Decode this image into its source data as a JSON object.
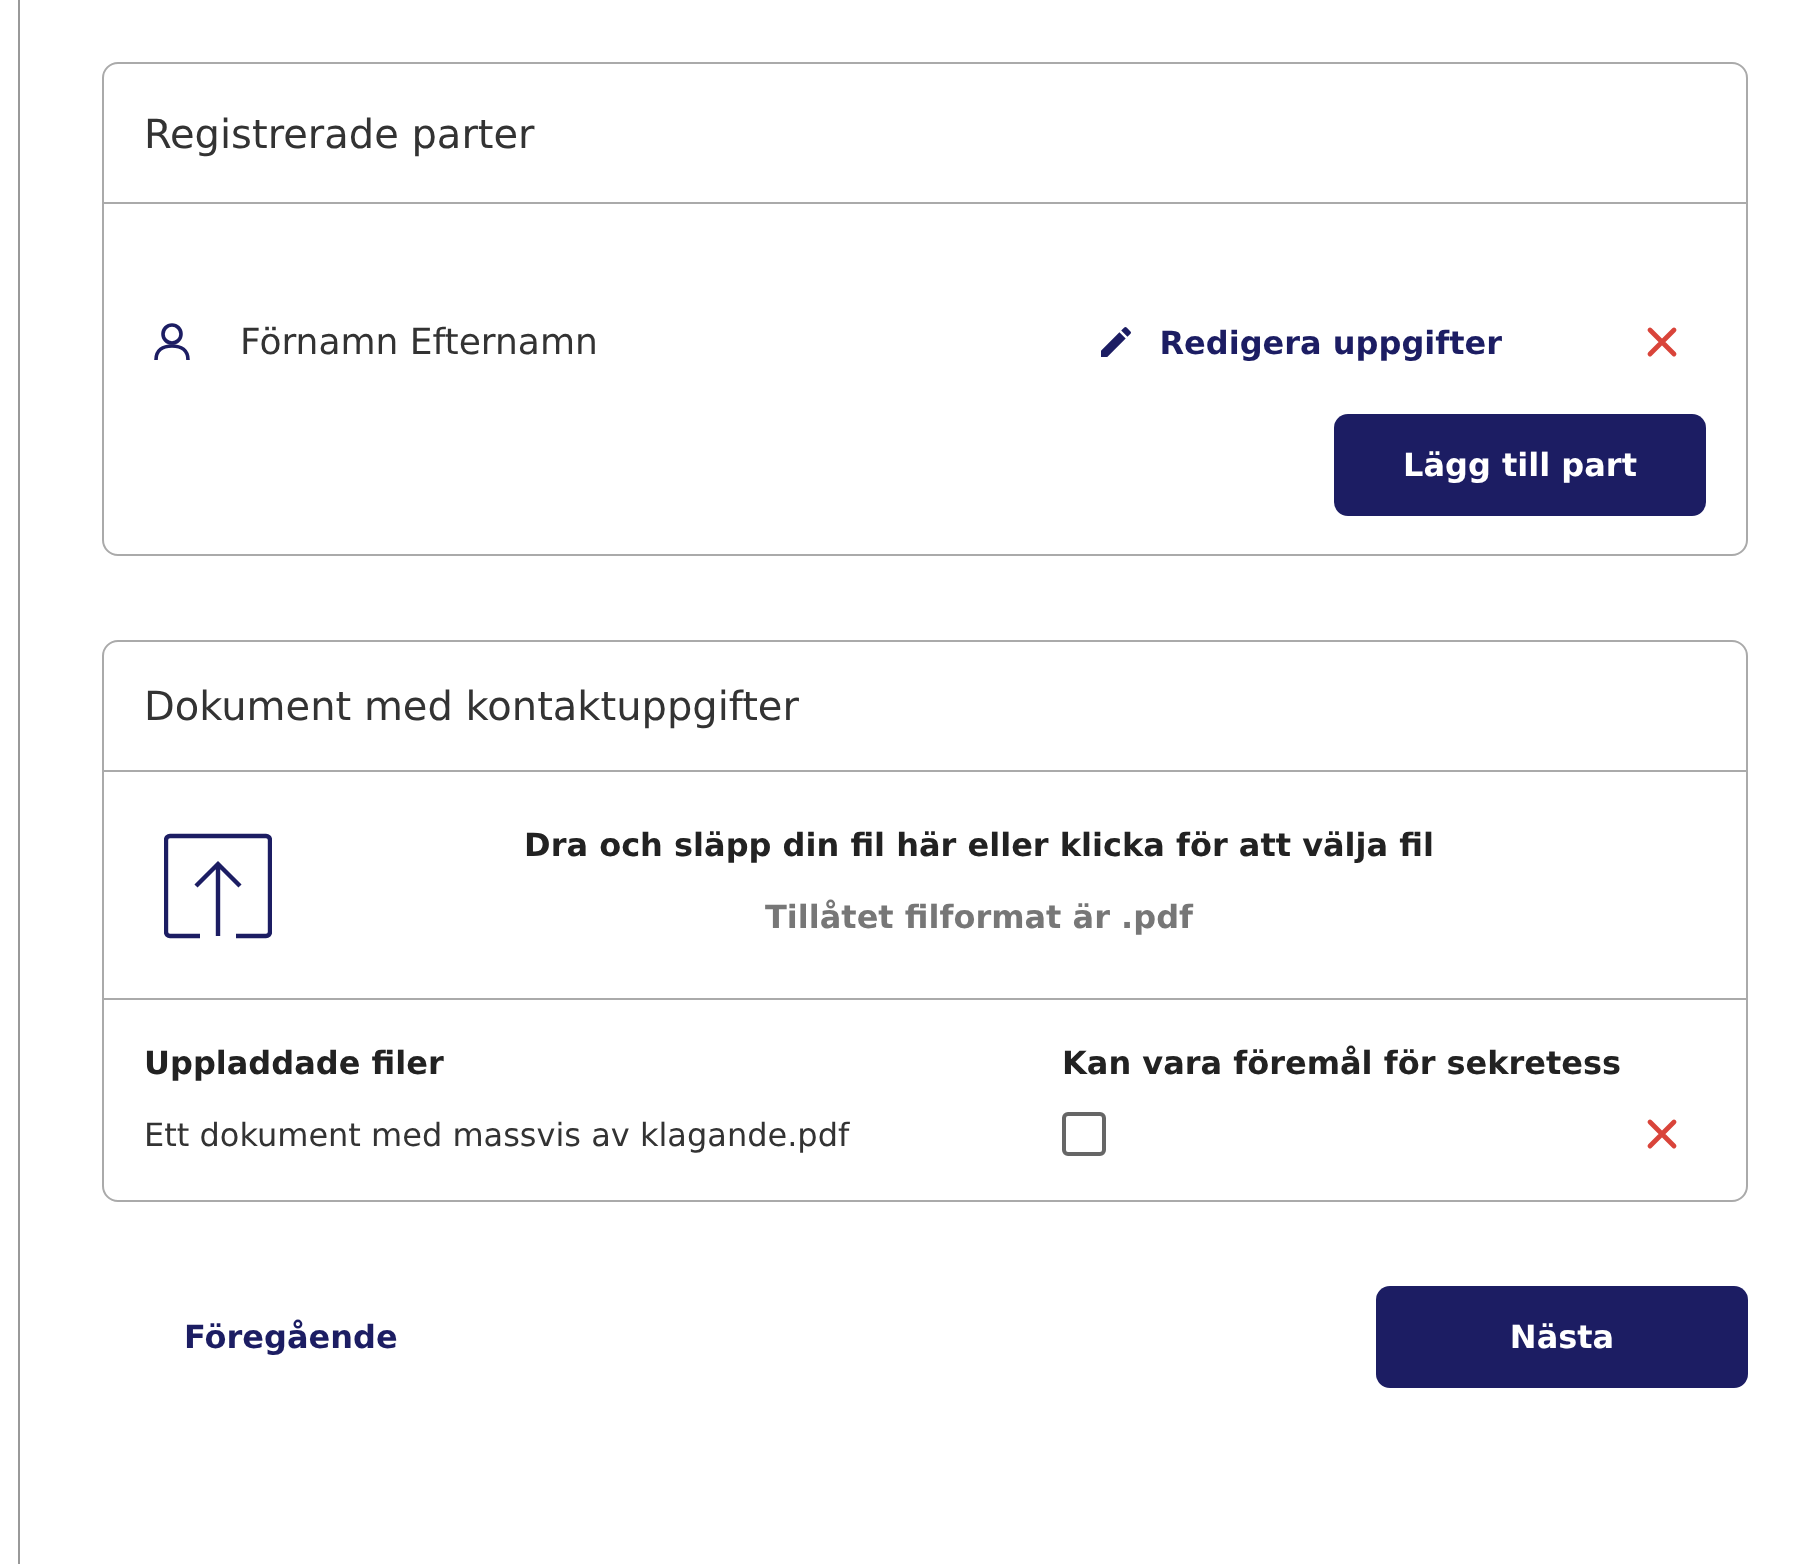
{
  "parties": {
    "title": "Registrerade parter",
    "items": [
      {
        "name": "Förnamn Efternamn",
        "edit_link": "Redigera uppgifter"
      }
    ],
    "add_button": "Lägg till part"
  },
  "documents": {
    "title": "Dokument med kontaktuppgifter",
    "dropzone": {
      "instruction": "Dra och släpp din fil här eller klicka för att välja fil",
      "hint": "Tillåtet filformat är .pdf"
    },
    "columns": [
      "Uppladdade filer",
      "Kan vara föremål för sekretess"
    ],
    "files": [
      {
        "name": "Ett dokument med massvis av klagande.pdf",
        "confidential": false
      }
    ]
  },
  "footer": {
    "back_link": "Föregående",
    "next_button": "Nästa"
  }
}
